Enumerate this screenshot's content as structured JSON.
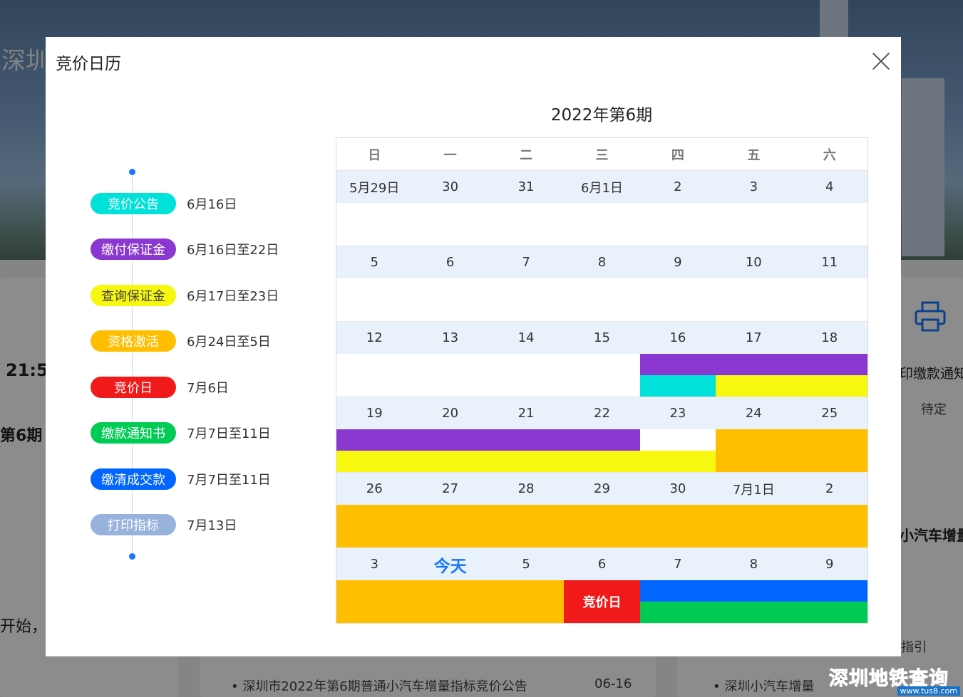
{
  "background": {
    "banner_text": "深圳",
    "time_fragment": "21:5",
    "period_fragment": "第6期",
    "start_fragment": "开始，",
    "print_label": "印缴款通知",
    "print_status": "待定",
    "right_fragment": "小汽车增量",
    "guide_fragment": "指引",
    "news_items": [
      {
        "title": "深圳市2022年第6期普通小汽车增量指标竞价公告",
        "date": "06-16"
      },
      {
        "title": "深圳小汽车增量",
        "date": ""
      }
    ]
  },
  "modal": {
    "title": "竞价日历"
  },
  "timeline": {
    "items": [
      {
        "label": "竞价公告",
        "date": "6月16日",
        "color": "#00e1d9"
      },
      {
        "label": "缴付保证金",
        "date": "6月16日至22日",
        "color": "#8a38d1"
      },
      {
        "label": "查询保证金",
        "date": "6月17日至23日",
        "color": "#f7f70f"
      },
      {
        "label": "资格激活",
        "date": "6月24日至5日",
        "color": "#ffbf00"
      },
      {
        "label": "竞价日",
        "date": "7月6日",
        "color": "#f11a1a"
      },
      {
        "label": "缴款通知书",
        "date": "7月7日至11日",
        "color": "#00cc55"
      },
      {
        "label": "缴清成交款",
        "date": "7月7日至11日",
        "color": "#0066ff"
      },
      {
        "label": "打印指标",
        "date": "7月13日",
        "color": "#97b3dc"
      }
    ]
  },
  "calendar": {
    "title": "2022年第6期",
    "weekdays": [
      "日",
      "一",
      "二",
      "三",
      "四",
      "五",
      "六"
    ],
    "weeks": [
      [
        "5月29日",
        "30",
        "31",
        "6月1日",
        "2",
        "3",
        "4"
      ],
      [
        "5",
        "6",
        "7",
        "8",
        "9",
        "10",
        "11"
      ],
      [
        "12",
        "13",
        "14",
        "15",
        "16",
        "17",
        "18"
      ],
      [
        "19",
        "20",
        "21",
        "22",
        "23",
        "24",
        "25"
      ],
      [
        "26",
        "27",
        "28",
        "29",
        "30",
        "7月1日",
        "2"
      ],
      [
        "3",
        "今天",
        "5",
        "6",
        "7",
        "8",
        "9"
      ]
    ],
    "bid_day_label": "竞价日"
  },
  "watermark": {
    "main": "深圳地铁查询",
    "sub": "www.tus8.com"
  }
}
